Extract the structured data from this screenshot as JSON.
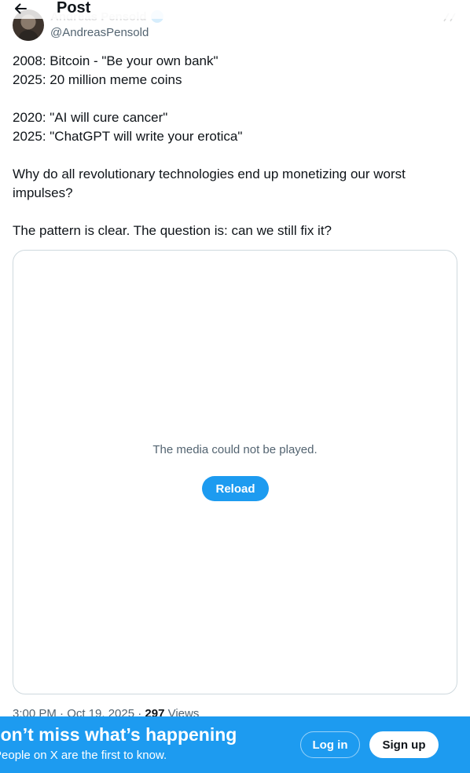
{
  "header": {
    "title": "Post",
    "back_icon": "arrow-left-icon"
  },
  "author": {
    "name": "Andreas Pensold",
    "handle": "@AndreasPensold",
    "verified_icon": "verified-badge-icon"
  },
  "tweet": {
    "text": "2008: Bitcoin - \"Be your own bank\"\n2025: 20 million meme coins\n\n2020: \"AI will cure cancer\"\n2025: \"ChatGPT will write your erotica\"\n\nWhy do all revolutionary technologies end up monetizing our worst impulses?\n\nThe pattern is clear. The question is: can we still fix it?"
  },
  "media": {
    "message": "The media could not be played.",
    "reload_label": "Reload"
  },
  "meta": {
    "timestamp": "3:00 PM · Oct 19, 2025 · ",
    "views_count": "297",
    "views_label": " Views"
  },
  "bottom_bar": {
    "headline": "Don’t miss what’s happening",
    "subtext": "People on X are the first to know.",
    "login_label": "Log in",
    "signup_label": "Sign up"
  },
  "colors": {
    "accent": "#1d9bf0",
    "text_primary": "#0f1419",
    "text_secondary": "#536471",
    "border": "#cfd9de"
  }
}
